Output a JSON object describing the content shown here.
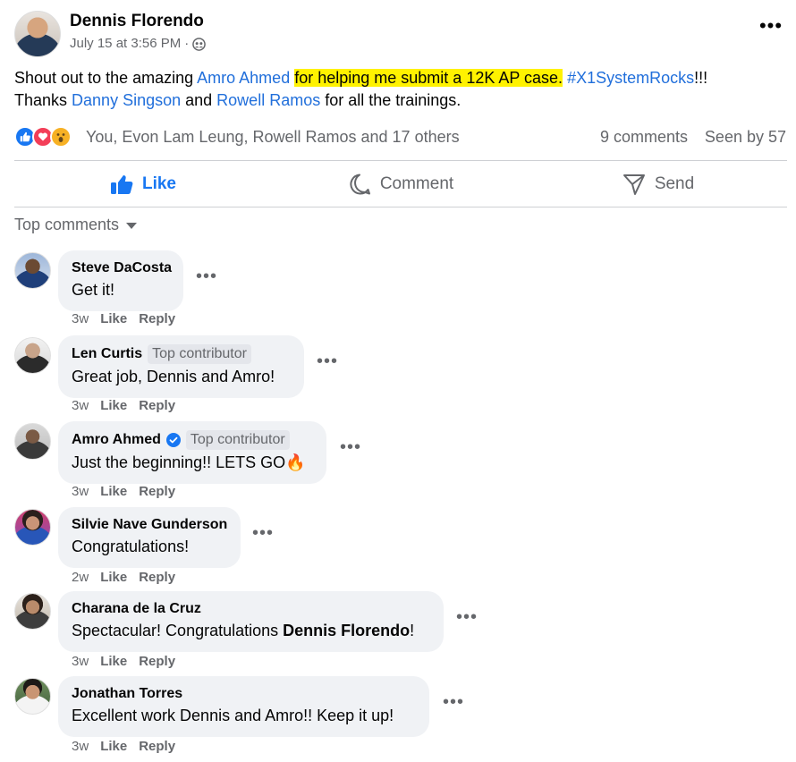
{
  "post": {
    "author": "Dennis Florendo",
    "timestamp": "July 15 at 3:56 PM",
    "separator": "·",
    "audience_icon": "group-icon",
    "text": {
      "part1": "Shout out to the amazing ",
      "mention1": "Amro Ahmed",
      "highlight": "for helping me submit a 12K AP case.",
      "hashtag": "#X1SystemRocks",
      "part2": "!!!",
      "part3": "Thanks ",
      "mention2": "Danny Singson",
      "part4": " and ",
      "mention3": "Rowell Ramos",
      "part5": " for all the trainings."
    }
  },
  "reactions": {
    "icons": [
      "like-reaction-icon",
      "love-reaction-icon",
      "wow-reaction-icon"
    ],
    "summary": "You, Evon Lam Leung, Rowell Ramos and 17 others",
    "comments": "9 comments",
    "seen": "Seen by 57"
  },
  "actions": {
    "like": "Like",
    "comment": "Comment",
    "send": "Send"
  },
  "sort": {
    "label": "Top comments"
  },
  "comments": [
    {
      "name": "Steve DaCosta",
      "badge": "",
      "verified": false,
      "text": "Get it!",
      "time": "3w",
      "like": "Like",
      "reply": "Reply"
    },
    {
      "name": "Len Curtis",
      "badge": "Top contributor",
      "verified": false,
      "text": "Great job, Dennis and Amro!",
      "time": "3w",
      "like": "Like",
      "reply": "Reply"
    },
    {
      "name": "Amro Ahmed",
      "badge": "Top contributor",
      "verified": true,
      "text": "Just the beginning!! LETS GO",
      "emoji": "🔥",
      "time": "3w",
      "like": "Like",
      "reply": "Reply"
    },
    {
      "name": "Silvie Nave Gunderson",
      "badge": "",
      "verified": false,
      "text": "Congratulations!",
      "time": "2w",
      "like": "Like",
      "reply": "Reply"
    },
    {
      "name": "Charana de la Cruz",
      "badge": "",
      "verified": false,
      "text_pre": "Spectacular! Congratulations ",
      "text_bold": "Dennis Florendo",
      "text_post": "!",
      "time": "3w",
      "like": "Like",
      "reply": "Reply"
    },
    {
      "name": "Jonathan Torres",
      "badge": "",
      "verified": false,
      "text": "Excellent work Dennis and Amro!! Keep it up!",
      "time": "3w",
      "like": "Like",
      "reply": "Reply"
    }
  ],
  "colors": {
    "link": "#216fdb",
    "highlight": "#fff200",
    "like_blue": "#1877f2",
    "bubble": "#f0f2f5",
    "secondary_text": "#65676b"
  }
}
